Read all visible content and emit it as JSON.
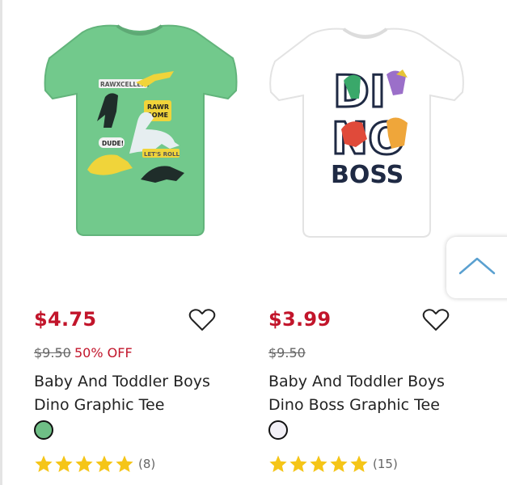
{
  "products": [
    {
      "price": "$4.75",
      "original_price": "$9.50",
      "discount": "50% OFF",
      "name_line1": "Baby And Toddler Boys",
      "name_line2": "Dino Graphic Tee",
      "swatch_color": "#6fbf86",
      "rating_count": "(8)",
      "stars": 5,
      "shirt_color": "#72c98c",
      "graphic_text": {
        "excellent": "RAWXCELLENT",
        "rawr": "RAWR",
        "some": "SOME",
        "dude": "DUDE!",
        "roll": "LET'S ROLL"
      }
    },
    {
      "price": "$3.99",
      "original_price": "$9.50",
      "name_line1": "Baby And Toddler Boys",
      "name_line2": "Dino Boss Graphic Tee",
      "swatch_color": "#f2f0f6",
      "rating_count": "(15)",
      "stars": 5,
      "shirt_color": "#ffffff",
      "graphic_text": {
        "di": "DI",
        "no": "NO",
        "boss": "BOSS"
      }
    }
  ],
  "colors": {
    "price": "#c2152b",
    "star": "#f5c518",
    "text": "#222222"
  },
  "icons": {
    "wishlist": "heart-outline-icon",
    "rating": "star-icon",
    "scroll": "chevron-up-icon"
  }
}
